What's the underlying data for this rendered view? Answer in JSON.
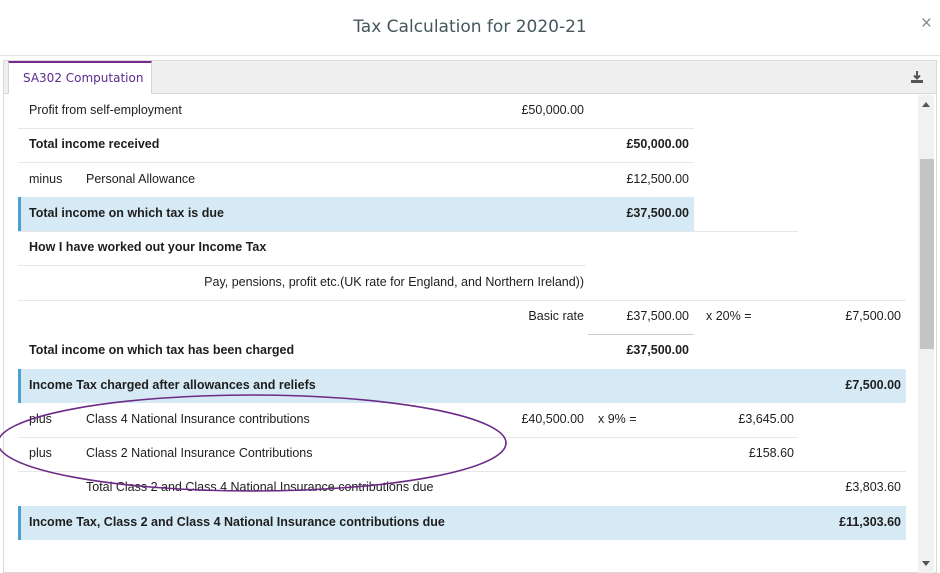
{
  "dialog": {
    "title": "Tax Calculation for 2020-21",
    "close_glyph": "×"
  },
  "tabs": [
    {
      "label": "SA302 Computation",
      "active": true
    }
  ],
  "toolbar": {
    "download_icon": "download-icon"
  },
  "rows": {
    "profit": {
      "label": "Profit from self-employment",
      "amount": "£50,000.00"
    },
    "total_income": {
      "label": "Total income received",
      "total": "£50,000.00"
    },
    "allowance": {
      "prefix": "minus",
      "label": "Personal Allowance",
      "total": "£12,500.00"
    },
    "taxable": {
      "label": "Total income on which tax is due",
      "total": "£37,500.00"
    },
    "how_worked": {
      "label": "How I have worked out your Income Tax"
    },
    "rate_note": {
      "label": "Pay, pensions, profit etc.(UK rate for England, and Northern Ireland))"
    },
    "basic_rate": {
      "label": "Basic rate",
      "amount": "£37,500.00",
      "calc": "x 20% =",
      "result": "£7,500.00"
    },
    "charged": {
      "label": "Total income on which tax has been charged",
      "total": "£37,500.00"
    },
    "income_tax": {
      "label": "Income Tax charged after allowances and reliefs",
      "result": "£7,500.00"
    },
    "class4": {
      "prefix": "plus",
      "label": "Class 4 National Insurance contributions",
      "amount": "£40,500.00",
      "calc": "x 9% =",
      "ni": "£3,645.00"
    },
    "class2": {
      "prefix": "plus",
      "label": "Class 2 National Insurance Contributions",
      "ni": "£158.60"
    },
    "total_ni": {
      "label": "Total Class 2 and Class 4 National Insurance contributions due",
      "result": "£3,803.60"
    },
    "grand_total": {
      "label": "Income Tax, Class 2 and Class 4 National Insurance contributions due",
      "result": "£11,303.60"
    }
  },
  "colors": {
    "highlight": "#d6eaf5",
    "accent": "#7a2a8e",
    "annotation": "#6b2a85"
  }
}
